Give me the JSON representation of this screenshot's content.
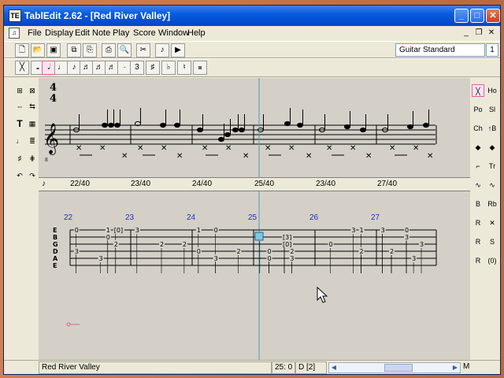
{
  "window": {
    "app_icon_text": "TE",
    "title": "TablEdit 2.62 - [Red River Valley]",
    "minimize": "_",
    "maximize": "□",
    "close": "✕"
  },
  "menubar": {
    "items": [
      "File",
      "Display",
      "Edit",
      "Note",
      "Play",
      "Score",
      "Window",
      "Help"
    ],
    "mdi_minimize": "_",
    "mdi_restore": "❐",
    "mdi_close": "✕"
  },
  "toolbar1": {
    "buttons": [
      "new-icon",
      "open-icon",
      "save-icon",
      "copy-module-icon",
      "paste-module-icon",
      "print-icon",
      "print-preview-icon",
      "cut-icon",
      "play-icon",
      "play-from-start-icon"
    ],
    "tuning": "Guitar Standard",
    "tuning_number": "1"
  },
  "toolbar2": {
    "buttons": [
      "rest-icon",
      "whole-note-icon",
      "half-note-icon",
      "quarter-note-icon",
      "eighth-note-icon",
      "sixteenth-note-icon",
      "thirtysecond-note-icon",
      "sixtyfourth-note-icon",
      "dot-icon",
      "triplet-icon",
      "sharp-icon",
      "flat-icon",
      "natural-icon",
      "double-sharp-icon"
    ]
  },
  "score": {
    "time_signature_top": "4",
    "time_signature_bottom": "4",
    "ruler_labels": [
      "22/40",
      "23/40",
      "24/40",
      "25/40",
      "23/40",
      "27/40"
    ],
    "measure_numbers": [
      "22",
      "23",
      "24",
      "25",
      "26",
      "27"
    ],
    "tab_strings": [
      "E",
      "B",
      "G",
      "D",
      "A",
      "E"
    ],
    "tab_numbers": [
      {
        "t": "0",
        "s": 1,
        "m": 0,
        "p": 0.1
      },
      {
        "t": "1",
        "s": 1,
        "m": 0,
        "p": 0.62
      },
      {
        "t": "0",
        "s": 2,
        "m": 0,
        "p": 0.62
      },
      {
        "t": "[0]",
        "s": 1,
        "m": 0,
        "p": 0.75
      },
      {
        "t": "3",
        "s": 4,
        "m": 0,
        "p": 0.1
      },
      {
        "t": "3",
        "s": 5,
        "m": 0,
        "p": 0.5
      },
      {
        "t": "2",
        "s": 3,
        "m": 0,
        "p": 0.75
      },
      {
        "t": "3",
        "s": 1,
        "m": 1,
        "p": 0.1
      },
      {
        "t": "2",
        "s": 3,
        "m": 1,
        "p": 0.5
      },
      {
        "t": "2",
        "s": 3,
        "m": 1,
        "p": 0.87
      },
      {
        "t": "1",
        "s": 1,
        "m": 2,
        "p": 0.1
      },
      {
        "t": "0",
        "s": 1,
        "m": 2,
        "p": 0.38
      },
      {
        "t": "0",
        "s": 4,
        "m": 2,
        "p": 0.1
      },
      {
        "t": "3",
        "s": 5,
        "m": 2,
        "p": 0.38
      },
      {
        "t": "2",
        "s": 4,
        "m": 2,
        "p": 0.75
      },
      {
        "t": "3",
        "s": 2,
        "m": 3,
        "p": 0.1
      },
      {
        "t": "[3]",
        "s": 2,
        "m": 3,
        "p": 0.5
      },
      {
        "t": "[0]",
        "s": 3,
        "m": 3,
        "p": 0.5
      },
      {
        "t": "0",
        "s": 4,
        "m": 3,
        "p": 0.25
      },
      {
        "t": "0",
        "s": 5,
        "m": 3,
        "p": 0.25
      },
      {
        "t": "2",
        "s": 4,
        "m": 3,
        "p": 0.62
      },
      {
        "t": "3",
        "s": 5,
        "m": 3,
        "p": 0.62
      },
      {
        "t": "0",
        "s": 3,
        "m": 4,
        "p": 0.25
      },
      {
        "t": "3",
        "s": 1,
        "m": 4,
        "p": 0.62
      },
      {
        "t": "1",
        "s": 1,
        "m": 4,
        "p": 0.75
      },
      {
        "t": "2",
        "s": 4,
        "m": 4,
        "p": 0.75
      },
      {
        "t": "0",
        "s": 1,
        "m": 5,
        "p": 0.1
      },
      {
        "t": "0",
        "s": 1,
        "m": 5,
        "p": 0.5
      },
      {
        "t": "0",
        "s": 4,
        "m": 5,
        "p": 0.25
      },
      {
        "t": "3",
        "s": 3,
        "m": 5,
        "p": 0.75
      },
      {
        "t": "3",
        "s": 1,
        "m": 6,
        "p": 0.1
      },
      {
        "t": "3",
        "s": 2,
        "m": 6,
        "p": 0.5
      },
      {
        "t": "2",
        "s": 4,
        "m": 6,
        "p": 0.25
      },
      {
        "t": "3",
        "s": 5,
        "m": 6,
        "p": 0.62
      }
    ]
  },
  "leftpal": {
    "items": [
      "insert-measure-icon",
      "delete-measure-icon",
      "stretch-icon",
      "compress-icon",
      "text-icon",
      "chord-diagram-icon",
      "fingering-icon",
      "lyrics-icon",
      "arpeggio-icon",
      "grid-icon",
      "undo-icon",
      "redo-icon"
    ],
    "labels": [
      "",
      "",
      "",
      "",
      "T",
      "",
      "",
      "",
      "",
      "",
      "",
      ""
    ]
  },
  "rightpal": {
    "labels": [
      "╳",
      "Ho",
      "Po",
      "Sl",
      "Ch",
      "↑B",
      "◆",
      "◆",
      "⌐",
      "Tr",
      "∿",
      "∿",
      "B",
      "Rb",
      "R",
      "✕",
      "R",
      "S",
      "R",
      "(0)"
    ],
    "names": [
      "dead-note-icon",
      "hammer-on-icon",
      "pull-off-icon",
      "slide-icon",
      "choke-icon",
      "bend-icon",
      "natural-harmonic-icon",
      "artificial-harmonic-icon",
      "accent-icon",
      "trill-icon",
      "vibrato-icon",
      "wide-vibrato-icon",
      "bend-release-icon",
      "release-bend-icon",
      "rake-icon",
      "x-note-icon",
      "rasgueado-icon",
      "staccato-icon",
      "arpeggio-right-icon",
      "ghost-note-icon"
    ]
  },
  "statusbar": {
    "title": "Red River Valley",
    "position": "25: 0",
    "duration": "D [2]",
    "marker": "M",
    "scroll_left": "◀",
    "scroll_right": "▶"
  }
}
